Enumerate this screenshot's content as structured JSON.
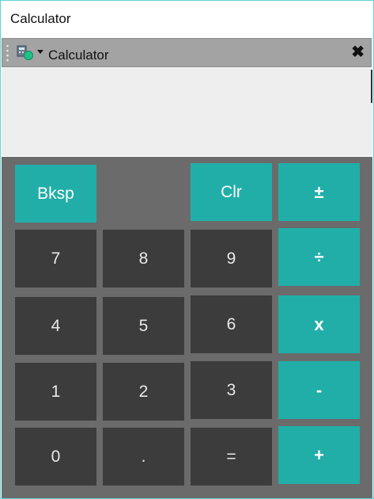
{
  "window": {
    "title": "Calculator"
  },
  "toolbar": {
    "icon": "calculator-app-icon",
    "title": "Calculator",
    "close_icon": "close-icon"
  },
  "display": {
    "value": ""
  },
  "keys": {
    "bksp": "Bksp",
    "clr": "Clr",
    "plus_minus": "±",
    "seven": "7",
    "eight": "8",
    "nine": "9",
    "divide": "÷",
    "four": "4",
    "five": "5",
    "six": "6",
    "multiply": "x",
    "one": "1",
    "two": "2",
    "three": "3",
    "subtract": "-",
    "zero": "0",
    "decimal": ".",
    "equals": "=",
    "add": "+"
  },
  "colors": {
    "accent": "#21aea8",
    "key_dark": "#3c3c3c",
    "keypad_bg": "#6b6b6b",
    "display_bg": "#eeeeee",
    "toolbar_bg": "#a3a3a3"
  }
}
